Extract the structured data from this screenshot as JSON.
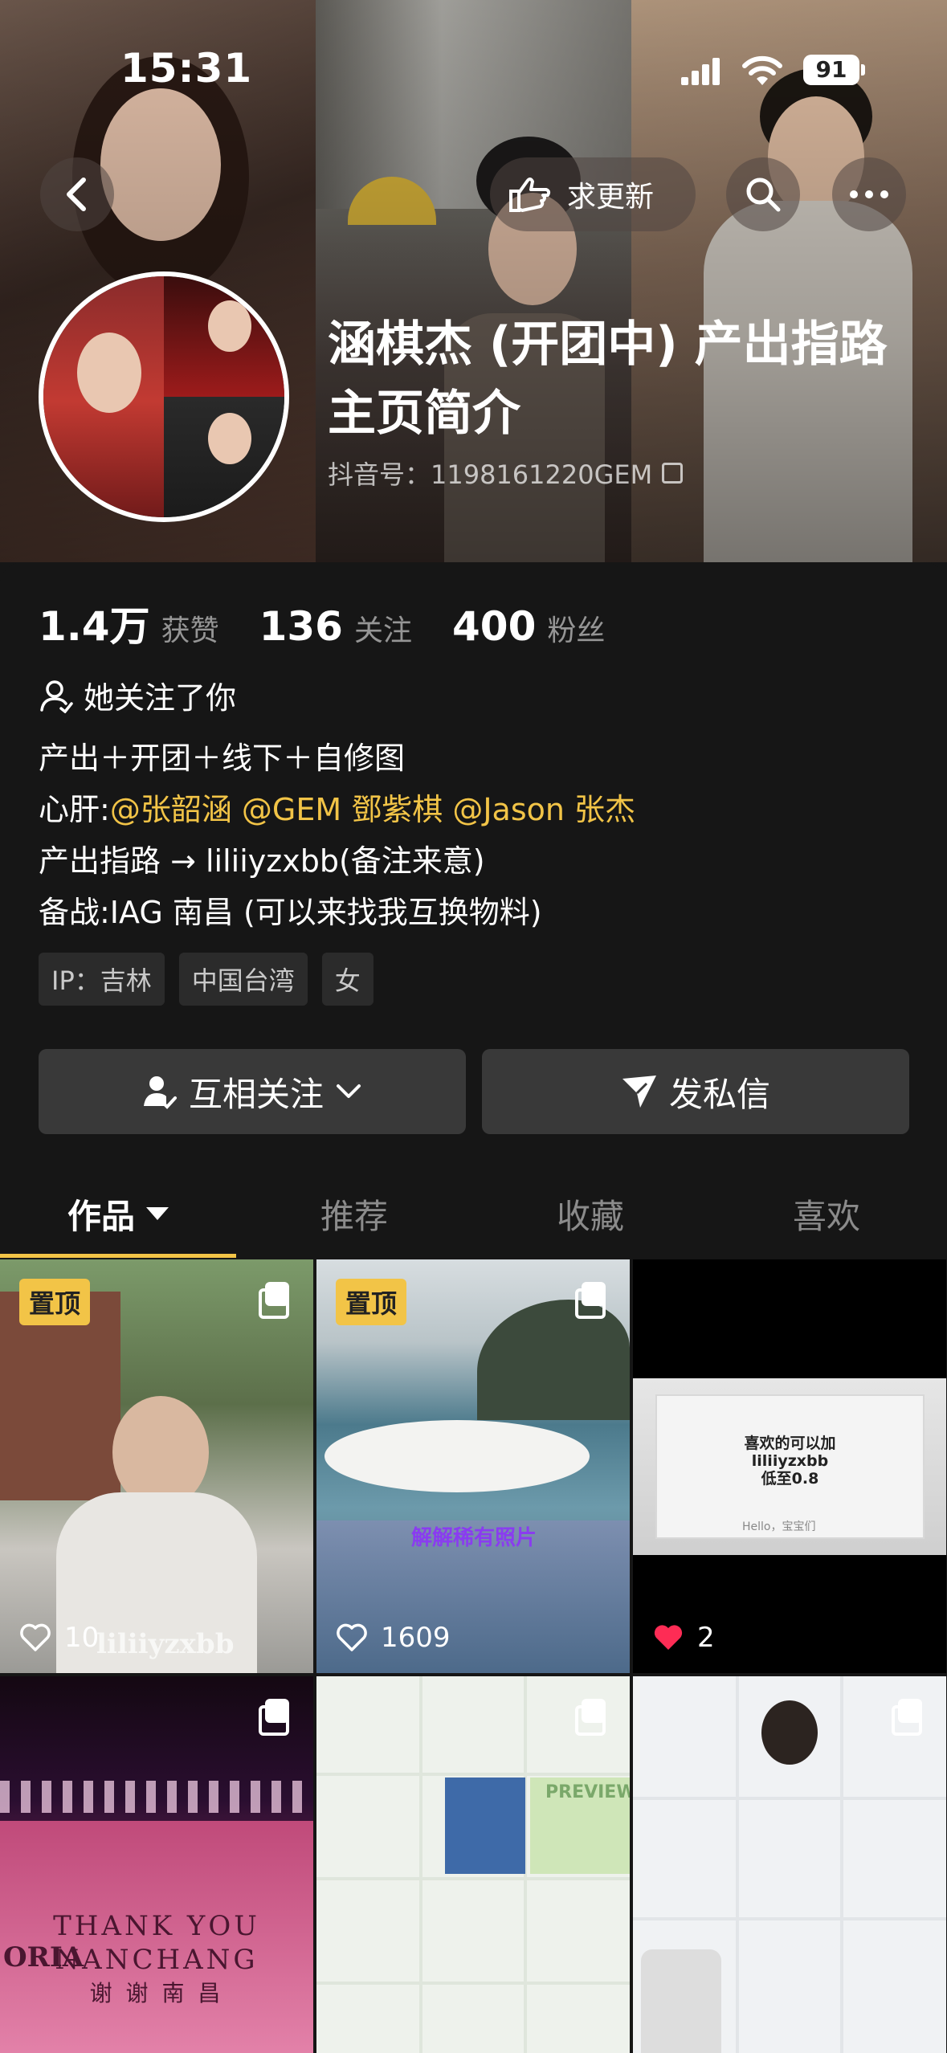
{
  "status_bar": {
    "time": "15:31",
    "battery": "91"
  },
  "nav": {
    "update_label": "求更新"
  },
  "profile": {
    "name": "涵棋杰 (开团中) 产出指路主页简介",
    "douyin_id": "抖音号：1198161220GEM"
  },
  "stats": [
    {
      "value": "1.4万",
      "label": "获赞"
    },
    {
      "value": "136",
      "label": "关注"
    },
    {
      "value": "400",
      "label": "粉丝"
    }
  ],
  "follows_you": "她关注了你",
  "bio": {
    "line1": "产出＋开团＋线下＋自修图",
    "line2_prefix": "心肝:",
    "mentions": [
      "@张韶涵",
      "@GEM 鄧紫棋",
      "@Jason 张杰"
    ],
    "line3": "产出指路 → liliiyzxbb(备注来意)",
    "line4": "备战:IAG 南昌 (可以来找我互换物料)"
  },
  "tags": [
    "IP：吉林",
    "中国台湾",
    "女"
  ],
  "actions": {
    "mutual": "互相关注",
    "message": "发私信"
  },
  "tabs": [
    "作品",
    "推荐",
    "收藏",
    "喜欢"
  ],
  "grid": [
    {
      "pinned": "置顶",
      "likes": "10",
      "watermark": "liliiyzxbb",
      "multi": true
    },
    {
      "pinned": "置顶",
      "likes": "1609",
      "overlay": "解解稀有照片",
      "multi": true
    },
    {
      "likes": "2",
      "liked": true,
      "overlay_lines": [
        "喜欢的可以加",
        "liliiyzxbb",
        "低至0.8"
      ],
      "small": "Hello，宝宝们"
    },
    {
      "overlay_lines": [
        "THANK YOU",
        "NANCHANG",
        "谢 谢 南 昌"
      ],
      "side": "ORIA",
      "multi": true
    },
    {
      "overlay": "PREVIEW",
      "multi": true
    },
    {
      "multi": true
    }
  ],
  "colors": {
    "accent": "#f2c447",
    "like_red": "#fe2c55",
    "bg": "#161616"
  }
}
